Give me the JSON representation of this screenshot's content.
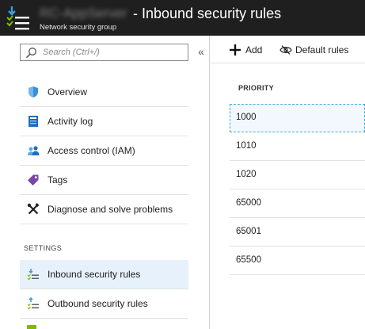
{
  "header": {
    "resource_name": "RC-AppServer",
    "title": "- Inbound security rules",
    "subtitle": "Network security group",
    "logo_icon": "network-security-group-icon"
  },
  "sidebar": {
    "search": {
      "placeholder": "Search (Ctrl+/)",
      "value": ""
    },
    "collapse_label": "«",
    "items": [
      {
        "label": "Overview",
        "icon": "shield-icon"
      },
      {
        "label": "Activity log",
        "icon": "activity-log-icon"
      },
      {
        "label": "Access control (IAM)",
        "icon": "people-icon"
      },
      {
        "label": "Tags",
        "icon": "tag-icon"
      },
      {
        "label": "Diagnose and solve problems",
        "icon": "wrench-icon"
      }
    ],
    "settings_label": "SETTINGS",
    "settings_items": [
      {
        "label": "Inbound security rules",
        "icon": "inbound-rules-icon",
        "active": true
      },
      {
        "label": "Outbound security rules",
        "icon": "outbound-rules-icon",
        "active": false
      }
    ]
  },
  "toolbar": {
    "add_label": "Add",
    "default_rules_label": "Default rules"
  },
  "table": {
    "column_header": "PRIORITY",
    "rows": [
      "1000",
      "1010",
      "1020",
      "65000",
      "65001",
      "65500"
    ]
  },
  "colors": {
    "header_bg": "#1f1f1f",
    "active_item_bg": "#e6f1fb",
    "selection_border": "#46a8d8"
  }
}
